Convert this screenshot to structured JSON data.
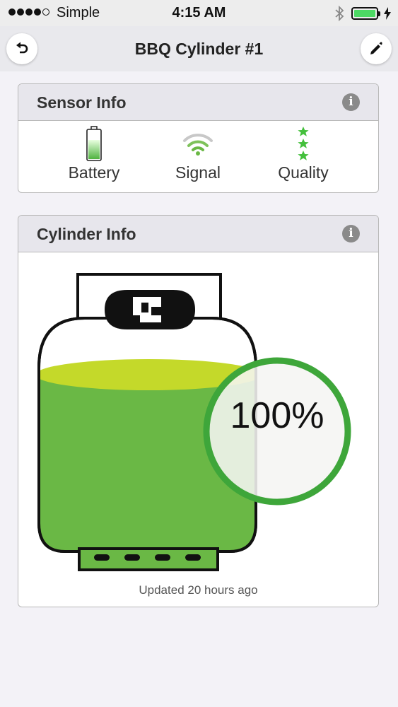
{
  "status_bar": {
    "carrier": "Simple",
    "time": "4:15 AM",
    "signal_dots_filled": 4,
    "signal_dots_total": 5,
    "battery_color": "#4cd964"
  },
  "nav": {
    "title": "BBQ Cylinder #1",
    "back_icon": "undo-arrow-icon",
    "edit_icon": "pencil-icon"
  },
  "sensor_info": {
    "title": "Sensor Info",
    "items": [
      {
        "label": "Battery",
        "icon": "battery-icon"
      },
      {
        "label": "Signal",
        "icon": "wifi-signal-icon"
      },
      {
        "label": "Quality",
        "icon": "stars-icon",
        "stars": 3
      }
    ]
  },
  "cylinder_info": {
    "title": "Cylinder Info",
    "fill_percent_label": "100%",
    "fill_fraction": 1.0,
    "updated": "Updated 20 hours ago",
    "fill_color": "#6ab845",
    "accent_color": "#3ea63a"
  }
}
